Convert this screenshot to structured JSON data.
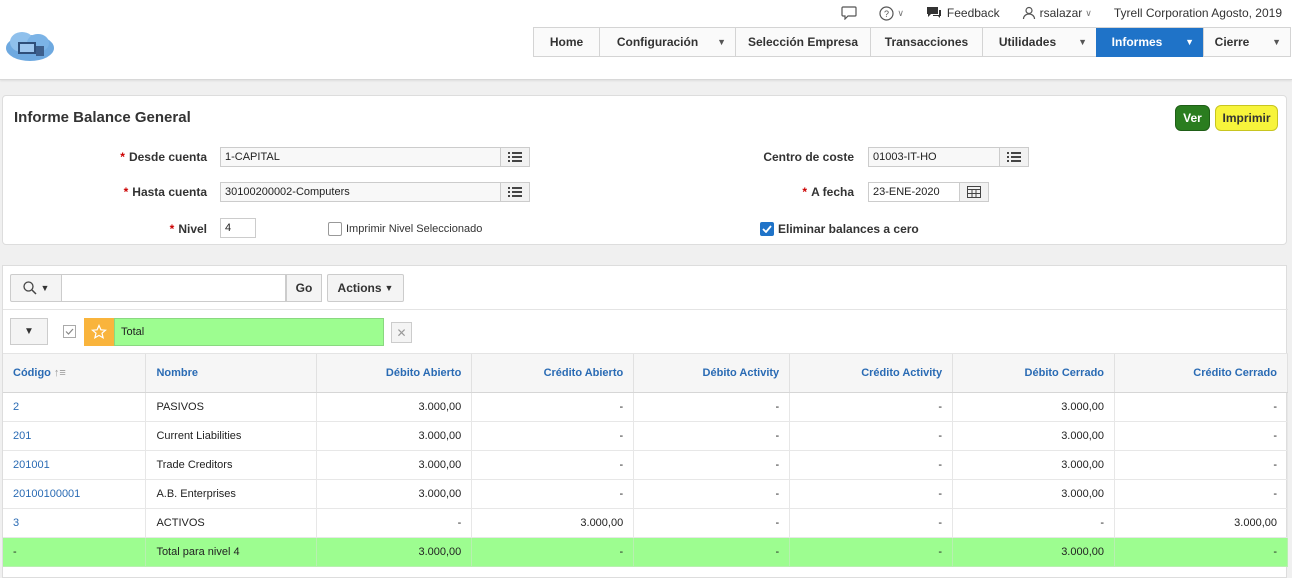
{
  "toplinks": {
    "feedback": "Feedback",
    "user": "rsalazar",
    "company": "Tyrell Corporation Agosto, 2019"
  },
  "nav": [
    {
      "label": "Home",
      "dropdown": false,
      "active": false
    },
    {
      "label": "Configuración",
      "dropdown": true,
      "active": false
    },
    {
      "label": "Selección Empresa",
      "dropdown": false,
      "active": false
    },
    {
      "label": "Transacciones",
      "dropdown": false,
      "active": false
    },
    {
      "label": "Utilidades",
      "dropdown": true,
      "active": false
    },
    {
      "label": "Informes",
      "dropdown": true,
      "active": true
    },
    {
      "label": "Cierre",
      "dropdown": true,
      "active": false
    }
  ],
  "form": {
    "title": "Informe Balance General",
    "ver_label": "Ver",
    "imprimir_label": "Imprimir",
    "required_mark": "*",
    "desde_cuenta_label": "Desde cuenta",
    "desde_cuenta_value": "1-CAPITAL",
    "hasta_cuenta_label": "Hasta cuenta",
    "hasta_cuenta_value": "30100200002-Computers",
    "nivel_label": "Nivel",
    "nivel_value": "4",
    "imprimir_nivel_label": "Imprimir Nivel Seleccionado",
    "imprimir_nivel_checked": false,
    "centro_coste_label": "Centro de coste",
    "centro_coste_value": "01003-IT-HO",
    "a_fecha_label": "A fecha",
    "a_fecha_value": "23-ENE-2020",
    "eliminar_label": "Eliminar balances a cero",
    "eliminar_checked": true
  },
  "report": {
    "go_label": "Go",
    "actions_label": "Actions",
    "filter_label": "Total",
    "columns": [
      "Código",
      "Nombre",
      "Débito Abierto",
      "Crédito Abierto",
      "Débito Activity",
      "Crédito Activity",
      "Débito Cerrado",
      "Crédito Cerrado"
    ],
    "rows": [
      [
        "2",
        "PASIVOS",
        "3.000,00",
        "-",
        "-",
        "-",
        "3.000,00",
        "-"
      ],
      [
        "201",
        "Current Liabilities",
        "3.000,00",
        "-",
        "-",
        "-",
        "3.000,00",
        "-"
      ],
      [
        "201001",
        "Trade Creditors",
        "3.000,00",
        "-",
        "-",
        "-",
        "3.000,00",
        "-"
      ],
      [
        "20100100001",
        "A.B. Enterprises",
        "3.000,00",
        "-",
        "-",
        "-",
        "3.000,00",
        "-"
      ],
      [
        "3",
        "ACTIVOS",
        "-",
        "3.000,00",
        "-",
        "-",
        "-",
        "3.000,00"
      ],
      [
        "-",
        "Total para nivel 4",
        "3.000,00",
        "-",
        "-",
        "-",
        "3.000,00",
        "-"
      ]
    ]
  },
  "colors": {
    "accent": "#1f73c8",
    "ver_button": "#2a7d1f",
    "imprimir_button": "#f7f43b",
    "total_row": "#9dfd90"
  }
}
